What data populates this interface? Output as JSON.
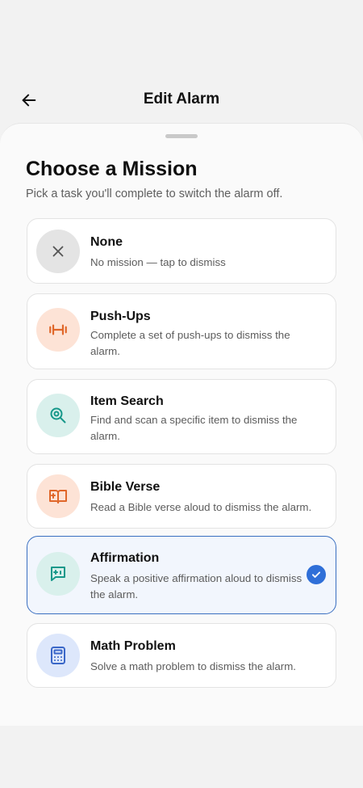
{
  "header": {
    "title": "Edit Alarm",
    "back_icon": "arrow-left-icon"
  },
  "sheet": {
    "title": "Choose a Mission",
    "subtitle": "Pick a task you'll complete to switch the alarm off."
  },
  "missions": [
    {
      "title": "None",
      "description": "No mission — tap to dismiss",
      "icon": "close-icon",
      "icon_bg": "#e4e4e4",
      "icon_color": "#555555",
      "selected": false
    },
    {
      "title": "Push-Ups",
      "description": "Complete a set of push-ups to dismiss the alarm.",
      "icon": "dumbbell-icon",
      "icon_bg": "#fde3d6",
      "icon_color": "#e0672a",
      "selected": false
    },
    {
      "title": "Item Search",
      "description": "Find and scan a specific item to dismiss the alarm.",
      "icon": "magnifier-icon",
      "icon_bg": "#d9f0ec",
      "icon_color": "#17988a",
      "selected": false
    },
    {
      "title": "Bible Verse",
      "description": "Read a Bible verse aloud to dismiss the alarm.",
      "icon": "book-icon",
      "icon_bg": "#fde3d6",
      "icon_color": "#e0672a",
      "selected": false
    },
    {
      "title": "Affirmation",
      "description": "Speak a positive affirmation aloud to dismiss the alarm.",
      "icon": "chat-bubble-icon",
      "icon_bg": "#d9f0ec",
      "icon_color": "#17988a",
      "selected": true
    },
    {
      "title": "Math Problem",
      "description": "Solve a math problem to dismiss the alarm.",
      "icon": "calculator-icon",
      "icon_bg": "#dde7fb",
      "icon_color": "#3a67c8",
      "selected": false
    }
  ],
  "colors": {
    "selected_border": "#3a6fc0",
    "selected_bg": "#f2f6fd",
    "check": "#2f6fd8"
  }
}
